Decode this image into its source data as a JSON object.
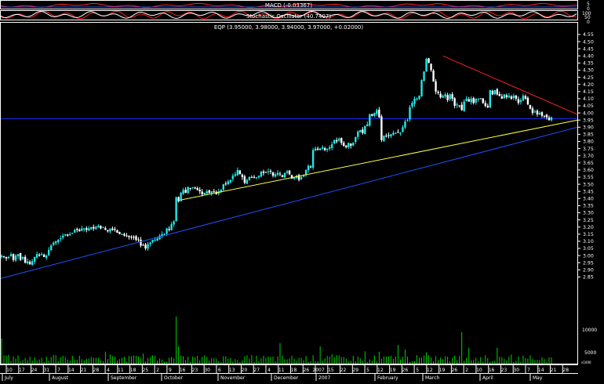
{
  "indicators": {
    "macd_label": "MACD (-0.03367)",
    "stoch_label": "Stochastic Oscillator (40.7407)",
    "macd_scale": [
      "5",
      "0"
    ],
    "stoch_scale": [
      "100",
      "50",
      "0"
    ]
  },
  "colors": {
    "background": "#000000",
    "candle_up": "#20e8e8",
    "candle_down": "#ffffff",
    "volume": "#00d000",
    "resistance_line": "#ff2020",
    "support_line": "#ffff40",
    "long_trend_line": "#2050ff",
    "horizontal_line": "#1030ff",
    "macd_line": "#ff2020",
    "grid_frame": "#ffffff"
  },
  "chart_data": {
    "type": "candlestick",
    "title": "EQP (3.95000, 3.98000, 3.94000, 3.97000, +0.02000)",
    "ylim": [
      2.77,
      4.57
    ],
    "yticks": [
      "4.55",
      "4.50",
      "4.45",
      "4.40",
      "4.35",
      "4.30",
      "4.25",
      "4.20",
      "4.15",
      "4.10",
      "4.05",
      "4.00",
      "3.95",
      "3.90",
      "3.85",
      "3.80",
      "3.75",
      "3.70",
      "3.65",
      "3.60",
      "3.55",
      "3.50",
      "3.45",
      "3.40",
      "3.35",
      "3.30",
      "3.25",
      "3.20",
      "3.15",
      "3.10",
      "3.05",
      "3.00",
      "2.95",
      "2.90",
      "2.85"
    ],
    "horizontal_level": 3.96,
    "volume_ticks": [
      "10000",
      "5000"
    ],
    "volume_unit": "x1000",
    "xtick_labels": [
      "10",
      "17",
      "24",
      "31",
      "7",
      "14",
      "21",
      "28",
      "4",
      "11",
      "18",
      "25",
      "2",
      "9",
      "16",
      "23",
      "30",
      "6",
      "13",
      "20",
      "27",
      "4",
      "11",
      "18",
      "26",
      "2007",
      "15",
      "22",
      "29",
      "5",
      "12",
      "19",
      "26",
      "5",
      "12",
      "19",
      "26",
      "2",
      "10",
      "16",
      "23",
      "30",
      "7",
      "14",
      "21",
      "28"
    ],
    "months": [
      "July",
      "August",
      "September",
      "October",
      "November",
      "December",
      "2007",
      "February",
      "March",
      "April",
      "May"
    ],
    "trend_lines": [
      {
        "name": "resistance",
        "from": [
          4.4,
          "Feb 14"
        ],
        "to": [
          3.99,
          "May 28"
        ]
      },
      {
        "name": "support",
        "from": [
          3.39,
          "Sep 26"
        ],
        "to": [
          3.95,
          "May 28"
        ]
      },
      {
        "name": "long-term trend",
        "from": [
          2.84,
          "Jul 3"
        ],
        "to": [
          3.9,
          "May 28"
        ]
      }
    ],
    "closes": [
      3.0,
      2.99,
      2.98,
      2.99,
      3.01,
      2.97,
      3.0,
      3.01,
      2.97,
      2.99,
      2.95,
      2.96,
      2.94,
      2.96,
      2.99,
      3.01,
      3.0,
      3.01,
      2.99,
      3.0,
      3.04,
      3.07,
      3.09,
      3.1,
      3.11,
      3.12,
      3.14,
      3.15,
      3.14,
      3.15,
      3.16,
      3.18,
      3.18,
      3.17,
      3.19,
      3.19,
      3.18,
      3.19,
      3.2,
      3.19,
      3.2,
      3.21,
      3.19,
      3.2,
      3.18,
      3.17,
      3.19,
      3.18,
      3.18,
      3.16,
      3.15,
      3.15,
      3.14,
      3.14,
      3.13,
      3.13,
      3.13,
      3.11,
      3.11,
      3.07,
      3.07,
      3.05,
      3.08,
      3.09,
      3.11,
      3.11,
      3.12,
      3.14,
      3.15,
      3.15,
      3.19,
      3.18,
      3.22,
      3.24,
      3.41,
      3.38,
      3.44,
      3.46,
      3.44,
      3.48,
      3.47,
      3.48,
      3.47,
      3.46,
      3.45,
      3.43,
      3.44,
      3.45,
      3.44,
      3.45,
      3.45,
      3.43,
      3.45,
      3.46,
      3.5,
      3.5,
      3.52,
      3.53,
      3.56,
      3.57,
      3.6,
      3.57,
      3.55,
      3.51,
      3.53,
      3.55,
      3.55,
      3.55,
      3.55,
      3.56,
      3.59,
      3.58,
      3.58,
      3.59,
      3.59,
      3.56,
      3.57,
      3.58,
      3.57,
      3.55,
      3.58,
      3.59,
      3.57,
      3.54,
      3.55,
      3.56,
      3.53,
      3.55,
      3.56,
      3.6,
      3.63,
      3.62,
      3.74,
      3.75,
      3.74,
      3.75,
      3.76,
      3.74,
      3.75,
      3.76,
      3.78,
      3.81,
      3.8,
      3.82,
      3.79,
      3.77,
      3.76,
      3.79,
      3.77,
      3.79,
      3.83,
      3.87,
      3.88,
      3.86,
      3.91,
      3.92,
      3.99,
      3.98,
      4.0,
      4.02,
      3.97,
      3.81,
      3.84,
      3.84,
      3.84,
      3.85,
      3.86,
      3.86,
      3.86,
      3.86,
      3.9,
      3.94,
      3.95,
      4.04,
      4.07,
      4.1,
      4.1,
      4.12,
      4.23,
      4.29,
      4.38,
      4.35,
      4.3,
      4.22,
      4.15,
      4.14,
      4.11,
      4.12,
      4.13,
      4.09,
      4.13,
      4.1,
      4.05,
      4.06,
      4.05,
      4.02,
      4.08,
      4.1,
      4.08,
      4.1,
      4.07,
      4.1,
      4.1,
      4.1,
      4.07,
      4.05,
      4.04,
      4.16,
      4.13,
      4.16,
      4.13,
      4.12,
      4.1,
      4.13,
      4.11,
      4.12,
      4.1,
      4.12,
      4.1,
      4.07,
      4.09,
      4.12,
      4.1,
      4.06,
      4.03,
      4.0,
      4.01,
      3.99,
      4.0,
      3.98,
      3.98,
      3.97,
      3.95,
      3.97
    ]
  }
}
